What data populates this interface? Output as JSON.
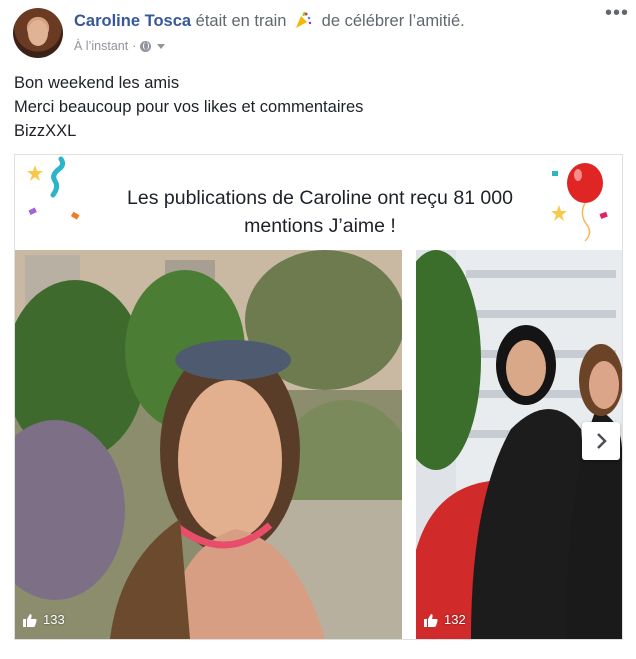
{
  "post": {
    "author": "Caroline Tosca",
    "action_prefix": "était en train",
    "action_suffix": "de célébrer l’amitié.",
    "timestamp": "À l’instant",
    "privacy_icon": "globe-icon",
    "more_icon": "more-options-icon",
    "text_lines": [
      "Bon weekend les amis",
      "Merci beaucoup pour vos likes et commentaires",
      "BizzXXL"
    ]
  },
  "card": {
    "title_line1": "Les publications de Caroline ont reçu 81 000",
    "title_line2": "mentions J’aime !",
    "photos": [
      {
        "likes": "133",
        "icon": "like-thumb-icon"
      },
      {
        "likes": "132",
        "icon": "like-thumb-icon"
      }
    ],
    "next_icon": "chevron-right-icon"
  },
  "colors": {
    "author_link": "#365899",
    "meta_text": "#90949c",
    "body_text": "#1d2129",
    "border": "#dddfe2"
  }
}
